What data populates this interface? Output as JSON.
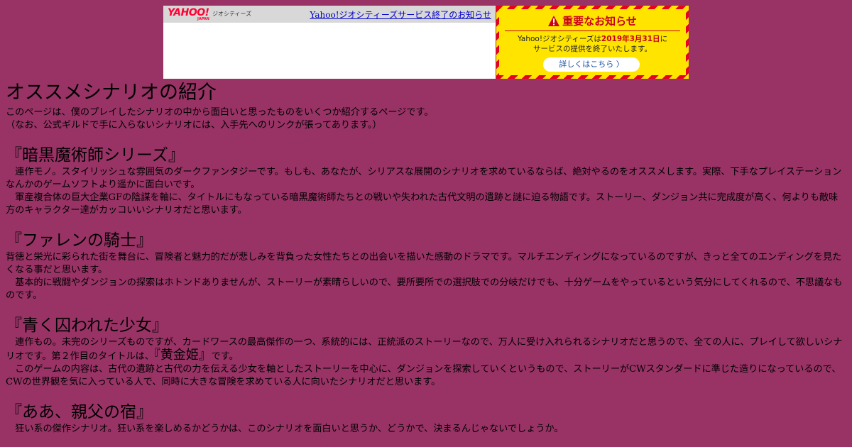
{
  "geocities_bar": {
    "logo_text": "YAHOO!",
    "logo_sub": "JAPAN",
    "service_name": "ジオシティーズ",
    "link_text": "Yahoo!ジオシティーズサービス終了のお知らせ"
  },
  "notice": {
    "title": "重要なお知らせ",
    "body_line1_pre": "Yahoo!ジオシティーズは",
    "body_line1_date": "2019年3月31日",
    "body_line1_post": "に",
    "body_line2": "サービスの提供を終了いたします。",
    "button_label": "詳しくはこちら 〉",
    "colors": {
      "stripe_red": "#e8001e",
      "stripe_yellow": "#ffe400"
    }
  },
  "page": {
    "title": "オススメシナリオの紹介",
    "intro_1": "このページは、僕のプレイしたシナリオの中から面白いと思ったものをいくつか紹介するページです。",
    "intro_2": "（なお、公式ギルドで手に入らないシナリオには、入手先へのリンクが張ってあります。）",
    "background_color": "#993366"
  },
  "sections": [
    {
      "heading": "『暗黒魔術師シリーズ』",
      "paragraphs": [
        "　連作モノ。スタイリッシュな雰囲気のダークファンタジーです。もしも、あなたが、シリアスな展開のシナリオを求めているならば、絶対やるのをオススメします。実際、下手なプレイステーションなんかのゲームソフトより遥かに面白いです。",
        "　軍産複合体の巨大企業GFの陰謀を軸に、タイトルにもなっている暗黒魔術師たちとの戦いや失われた古代文明の遺跡と謎に迫る物語です。ストーリー、ダンジョン共に完成度が高く、何よりも敵味方のキャラクター達がカッコいいシナリオだと思います。"
      ]
    },
    {
      "heading": "『ファレンの騎士』",
      "paragraphs": [
        "背徳と栄光に彩られた街を舞台に、冒険者と魅力的だが悲しみを背負った女性たちとの出会いを描いた感動のドラマです。マルチエンディングになっているのですが、きっと全てのエンディングを見たくなる事だと思います。",
        "　基本的に戦闘やダンジョンの探索はホトンドありませんが、ストーリーが素晴らしいので、要所要所での選択肢での分岐だけでも、十分ゲームをやっているという気分にしてくれるので、不思議なものです。"
      ]
    },
    {
      "heading": "『青く囚われた少女』",
      "para1_pre": "　連作もの。未完のシリーズものですが、カードワースの最高傑作の一つ、系統的には、正統派のストーリーなので、万人に受け入れられるシナリオだと思うので、全ての人に、プレイして欲しいシナリオです。第２作目のタイトルは、",
      "para1_title": "『黄金姫』",
      "para1_post": "です。",
      "para2": "　このゲームの内容は、古代の遺跡と古代の力を伝える少女を軸としたストーリーを中心に、ダンジョンを探索していくというもので、ストーリーがCWスタンダードに準じた造りになっているので、CWの世界観を気に入っている人で、同時に大きな冒険を求めている人に向いたシナリオだと思います。"
    },
    {
      "heading": "『ああ、親父の宿』",
      "paragraphs": [
        "　狂い系の傑作シナリオ。狂い系を楽しめるかどうかは、このシナリオを面白いと思うか、どうかで、決まるんじゃないでしょうか。"
      ]
    }
  ]
}
